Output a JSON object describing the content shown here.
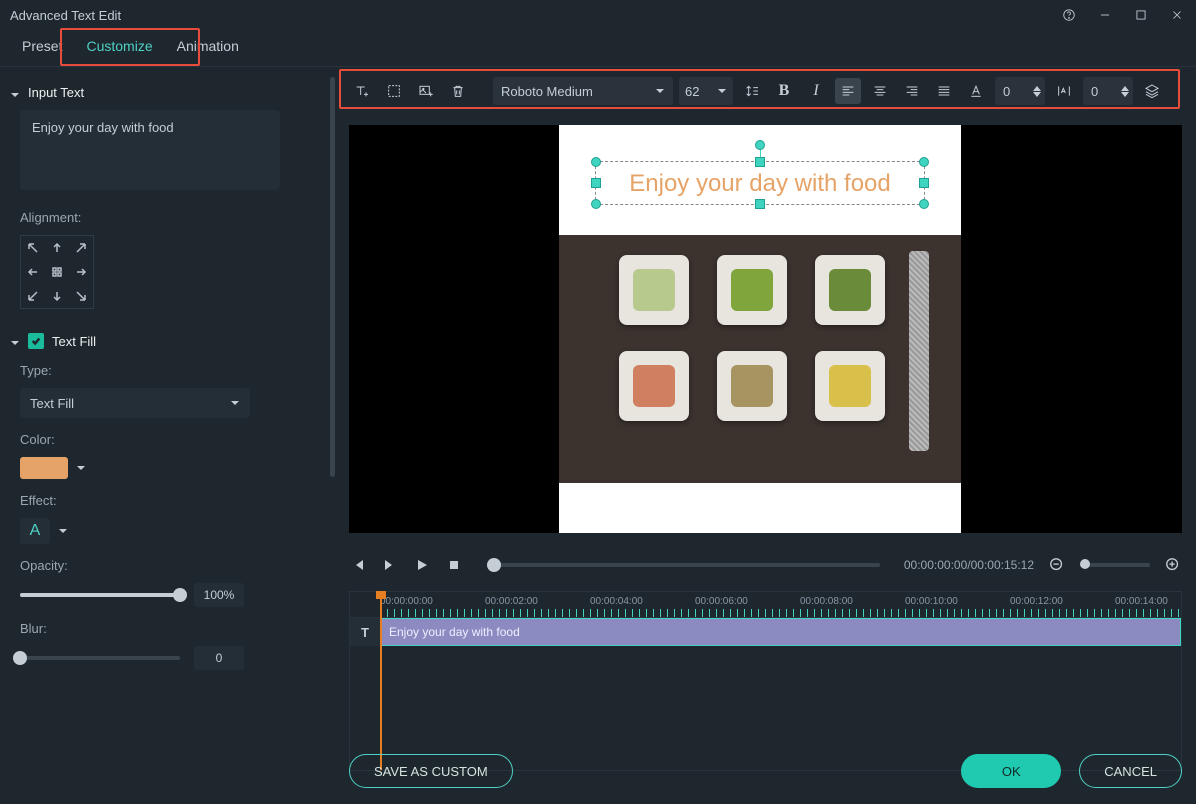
{
  "window": {
    "title": "Advanced Text Edit"
  },
  "tabs": {
    "preset": "Preset",
    "customize": "Customize",
    "animation": "Animation"
  },
  "left": {
    "input_section": "Input Text",
    "input_value": "Enjoy your day with food",
    "alignment_label": "Alignment:",
    "textfill_section": "Text Fill",
    "type_label": "Type:",
    "type_value": "Text Fill",
    "color_label": "Color:",
    "color_value": "#e6a368",
    "effect_label": "Effect:",
    "effect_placeholder": "A",
    "opacity_label": "Opacity:",
    "opacity_value": "100%",
    "blur_label": "Blur:",
    "blur_value": "0"
  },
  "toolbar": {
    "font": "Roboto Medium",
    "size": "62",
    "line_spacing": "0",
    "char_spacing": "0"
  },
  "preview": {
    "text": "Enjoy your day with food"
  },
  "playback": {
    "timecode": "00:00:00:00/00:00:15:12"
  },
  "timeline": {
    "ticks": [
      "00:00:00:00",
      "00:00:02:00",
      "00:00:04:00",
      "00:00:06:00",
      "00:00:08:00",
      "00:00:10:00",
      "00:00:12:00",
      "00:00:14:00"
    ],
    "clip_label": "Enjoy your day with food",
    "track_icon": "T"
  },
  "buttons": {
    "save_custom": "SAVE AS CUSTOM",
    "ok": "OK",
    "cancel": "CANCEL"
  }
}
